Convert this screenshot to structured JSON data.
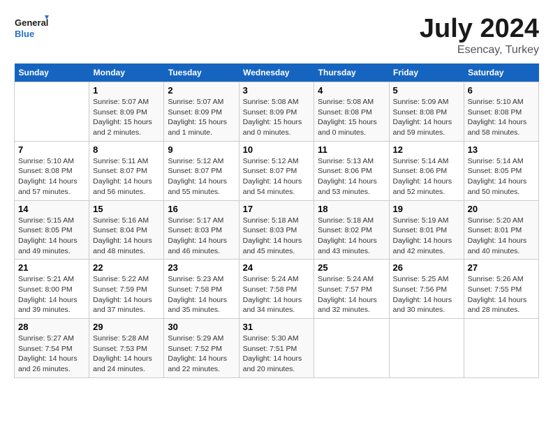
{
  "logo": {
    "text_general": "General",
    "text_blue": "Blue"
  },
  "title": "July 2024",
  "subtitle": "Esencay, Turkey",
  "days_header": [
    "Sunday",
    "Monday",
    "Tuesday",
    "Wednesday",
    "Thursday",
    "Friday",
    "Saturday"
  ],
  "weeks": [
    [
      {
        "day": "",
        "info": ""
      },
      {
        "day": "1",
        "info": "Sunrise: 5:07 AM\nSunset: 8:09 PM\nDaylight: 15 hours\nand 2 minutes."
      },
      {
        "day": "2",
        "info": "Sunrise: 5:07 AM\nSunset: 8:09 PM\nDaylight: 15 hours\nand 1 minute."
      },
      {
        "day": "3",
        "info": "Sunrise: 5:08 AM\nSunset: 8:09 PM\nDaylight: 15 hours\nand 0 minutes."
      },
      {
        "day": "4",
        "info": "Sunrise: 5:08 AM\nSunset: 8:08 PM\nDaylight: 15 hours\nand 0 minutes."
      },
      {
        "day": "5",
        "info": "Sunrise: 5:09 AM\nSunset: 8:08 PM\nDaylight: 14 hours\nand 59 minutes."
      },
      {
        "day": "6",
        "info": "Sunrise: 5:10 AM\nSunset: 8:08 PM\nDaylight: 14 hours\nand 58 minutes."
      }
    ],
    [
      {
        "day": "7",
        "info": "Sunrise: 5:10 AM\nSunset: 8:08 PM\nDaylight: 14 hours\nand 57 minutes."
      },
      {
        "day": "8",
        "info": "Sunrise: 5:11 AM\nSunset: 8:07 PM\nDaylight: 14 hours\nand 56 minutes."
      },
      {
        "day": "9",
        "info": "Sunrise: 5:12 AM\nSunset: 8:07 PM\nDaylight: 14 hours\nand 55 minutes."
      },
      {
        "day": "10",
        "info": "Sunrise: 5:12 AM\nSunset: 8:07 PM\nDaylight: 14 hours\nand 54 minutes."
      },
      {
        "day": "11",
        "info": "Sunrise: 5:13 AM\nSunset: 8:06 PM\nDaylight: 14 hours\nand 53 minutes."
      },
      {
        "day": "12",
        "info": "Sunrise: 5:14 AM\nSunset: 8:06 PM\nDaylight: 14 hours\nand 52 minutes."
      },
      {
        "day": "13",
        "info": "Sunrise: 5:14 AM\nSunset: 8:05 PM\nDaylight: 14 hours\nand 50 minutes."
      }
    ],
    [
      {
        "day": "14",
        "info": "Sunrise: 5:15 AM\nSunset: 8:05 PM\nDaylight: 14 hours\nand 49 minutes."
      },
      {
        "day": "15",
        "info": "Sunrise: 5:16 AM\nSunset: 8:04 PM\nDaylight: 14 hours\nand 48 minutes."
      },
      {
        "day": "16",
        "info": "Sunrise: 5:17 AM\nSunset: 8:03 PM\nDaylight: 14 hours\nand 46 minutes."
      },
      {
        "day": "17",
        "info": "Sunrise: 5:18 AM\nSunset: 8:03 PM\nDaylight: 14 hours\nand 45 minutes."
      },
      {
        "day": "18",
        "info": "Sunrise: 5:18 AM\nSunset: 8:02 PM\nDaylight: 14 hours\nand 43 minutes."
      },
      {
        "day": "19",
        "info": "Sunrise: 5:19 AM\nSunset: 8:01 PM\nDaylight: 14 hours\nand 42 minutes."
      },
      {
        "day": "20",
        "info": "Sunrise: 5:20 AM\nSunset: 8:01 PM\nDaylight: 14 hours\nand 40 minutes."
      }
    ],
    [
      {
        "day": "21",
        "info": "Sunrise: 5:21 AM\nSunset: 8:00 PM\nDaylight: 14 hours\nand 39 minutes."
      },
      {
        "day": "22",
        "info": "Sunrise: 5:22 AM\nSunset: 7:59 PM\nDaylight: 14 hours\nand 37 minutes."
      },
      {
        "day": "23",
        "info": "Sunrise: 5:23 AM\nSunset: 7:58 PM\nDaylight: 14 hours\nand 35 minutes."
      },
      {
        "day": "24",
        "info": "Sunrise: 5:24 AM\nSunset: 7:58 PM\nDaylight: 14 hours\nand 34 minutes."
      },
      {
        "day": "25",
        "info": "Sunrise: 5:24 AM\nSunset: 7:57 PM\nDaylight: 14 hours\nand 32 minutes."
      },
      {
        "day": "26",
        "info": "Sunrise: 5:25 AM\nSunset: 7:56 PM\nDaylight: 14 hours\nand 30 minutes."
      },
      {
        "day": "27",
        "info": "Sunrise: 5:26 AM\nSunset: 7:55 PM\nDaylight: 14 hours\nand 28 minutes."
      }
    ],
    [
      {
        "day": "28",
        "info": "Sunrise: 5:27 AM\nSunset: 7:54 PM\nDaylight: 14 hours\nand 26 minutes."
      },
      {
        "day": "29",
        "info": "Sunrise: 5:28 AM\nSunset: 7:53 PM\nDaylight: 14 hours\nand 24 minutes."
      },
      {
        "day": "30",
        "info": "Sunrise: 5:29 AM\nSunset: 7:52 PM\nDaylight: 14 hours\nand 22 minutes."
      },
      {
        "day": "31",
        "info": "Sunrise: 5:30 AM\nSunset: 7:51 PM\nDaylight: 14 hours\nand 20 minutes."
      },
      {
        "day": "",
        "info": ""
      },
      {
        "day": "",
        "info": ""
      },
      {
        "day": "",
        "info": ""
      }
    ]
  ]
}
